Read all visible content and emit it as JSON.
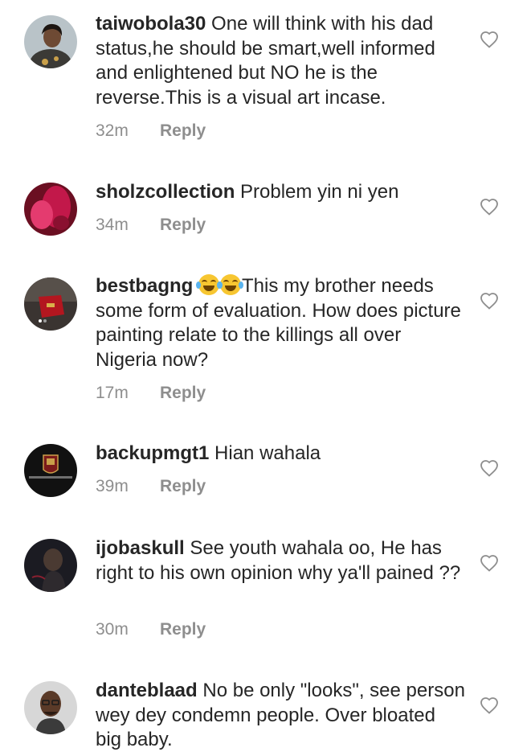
{
  "comments": [
    {
      "username": "taiwobola30",
      "text": "One will think with his dad status,he should be smart,well informed and enlightened but NO he is the reverse.This is a visual art incase.",
      "time": "32m",
      "reply_label": "Reply",
      "avatar_icon": "user-avatar-woman",
      "like_icon": "heart-outline-icon"
    },
    {
      "username": "sholzcollection",
      "text": "Problem yin ni yen",
      "time": "34m",
      "reply_label": "Reply",
      "avatar_icon": "user-avatar-red",
      "like_icon": "heart-outline-icon"
    },
    {
      "username": "bestbagng",
      "emoji_icons": [
        "face-with-tears-of-joy",
        "face-with-tears-of-joy"
      ],
      "text": "This my brother needs some form of evaluation. How does picture painting relate to the killings all over Nigeria now?",
      "time": "17m",
      "reply_label": "Reply",
      "avatar_icon": "user-avatar-bag",
      "like_icon": "heart-outline-icon"
    },
    {
      "username": "backupmgt1",
      "text": "Hian wahala",
      "time": "39m",
      "reply_label": "Reply",
      "avatar_icon": "user-avatar-logo",
      "like_icon": "heart-outline-icon"
    },
    {
      "username": "ijobaskull",
      "text": "See youth wahala oo, He has right to his own opinion why ya'll pained ??",
      "time": "30m",
      "reply_label": "Reply",
      "avatar_icon": "user-avatar-dark",
      "like_icon": "heart-outline-icon"
    },
    {
      "username": "danteblaad",
      "text": "No be only \"looks\", see person wey dey condemn people. Over bloated big baby.",
      "time": "",
      "reply_label": "",
      "avatar_icon": "user-avatar-man",
      "like_icon": "heart-outline-icon"
    }
  ]
}
